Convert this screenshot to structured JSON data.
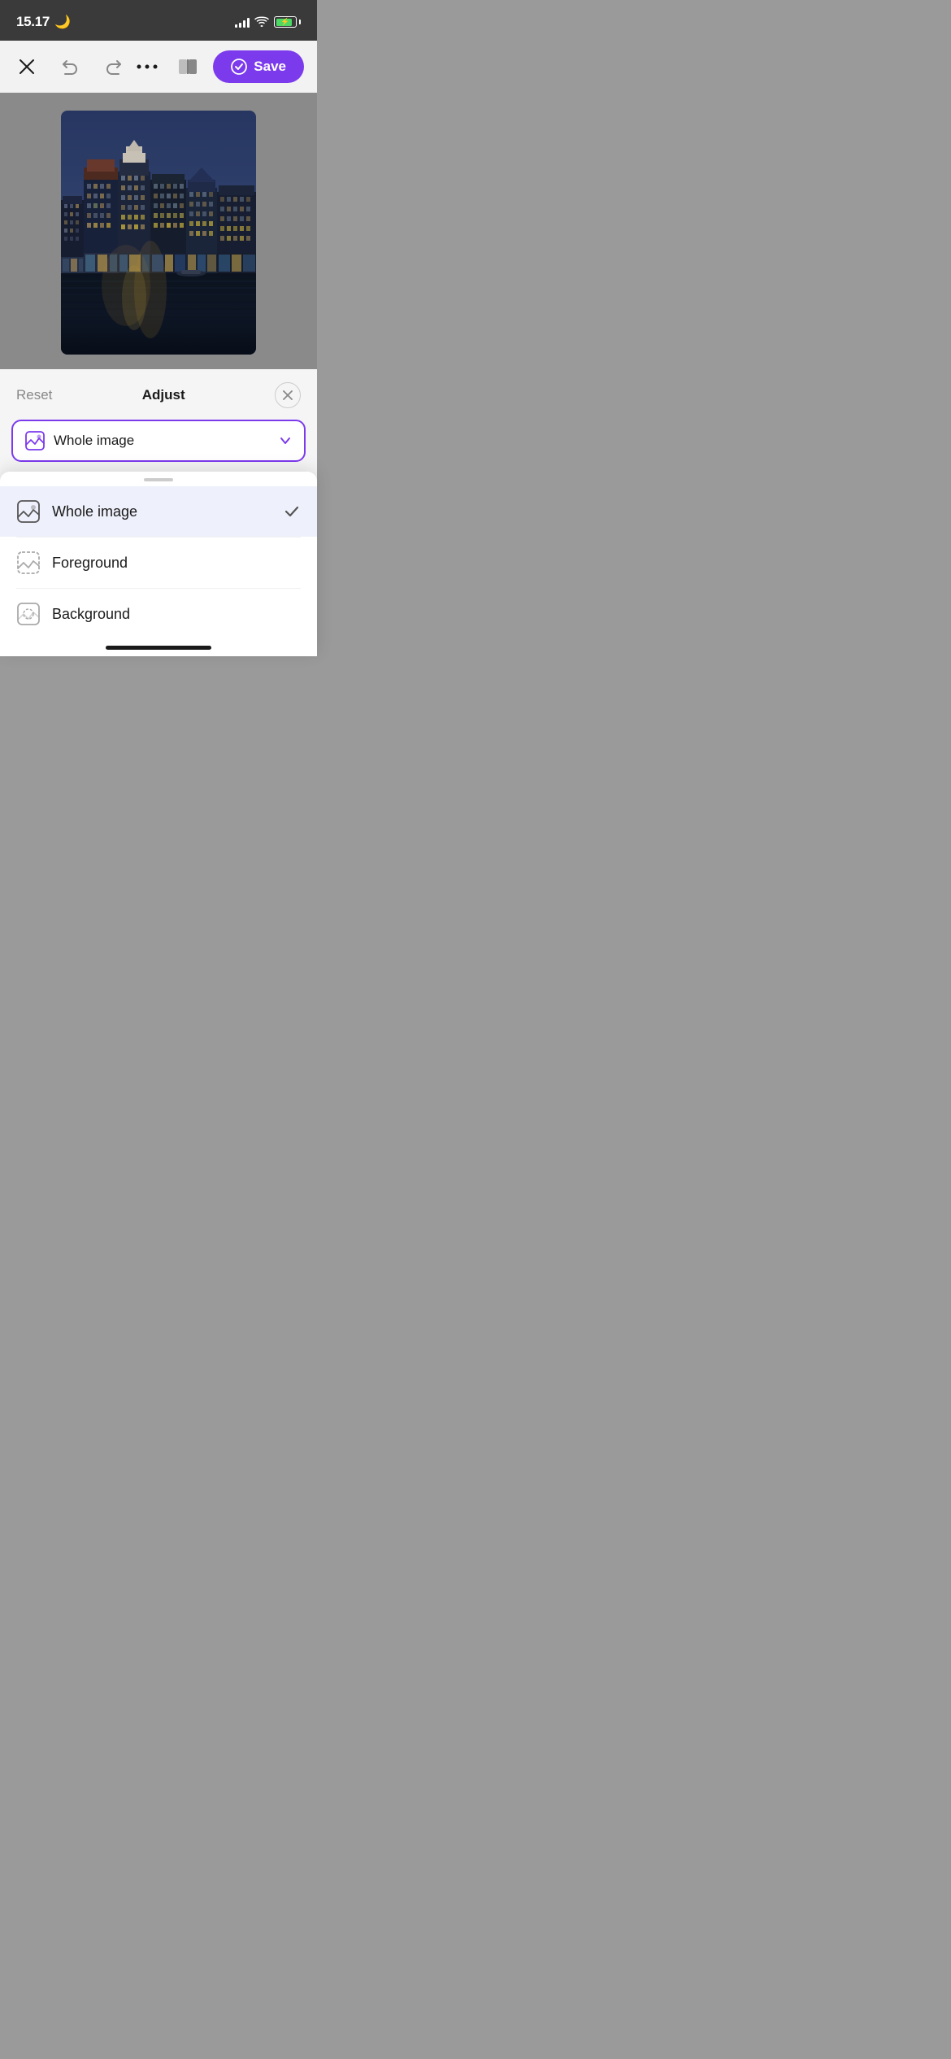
{
  "status": {
    "time": "15.17",
    "moon": "🌙"
  },
  "toolbar": {
    "save_label": "Save",
    "more_label": "...",
    "reset_label": "Reset",
    "adjust_label": "Adjust"
  },
  "dropdown": {
    "selected_label": "Whole image",
    "chevron": "chevron-down"
  },
  "options": [
    {
      "id": "whole_image",
      "label": "Whole image",
      "selected": true
    },
    {
      "id": "foreground",
      "label": "Foreground",
      "selected": false
    },
    {
      "id": "background",
      "label": "Background",
      "selected": false
    }
  ],
  "colors": {
    "purple_accent": "#7c3aed",
    "selected_bg": "#eef0fb"
  }
}
